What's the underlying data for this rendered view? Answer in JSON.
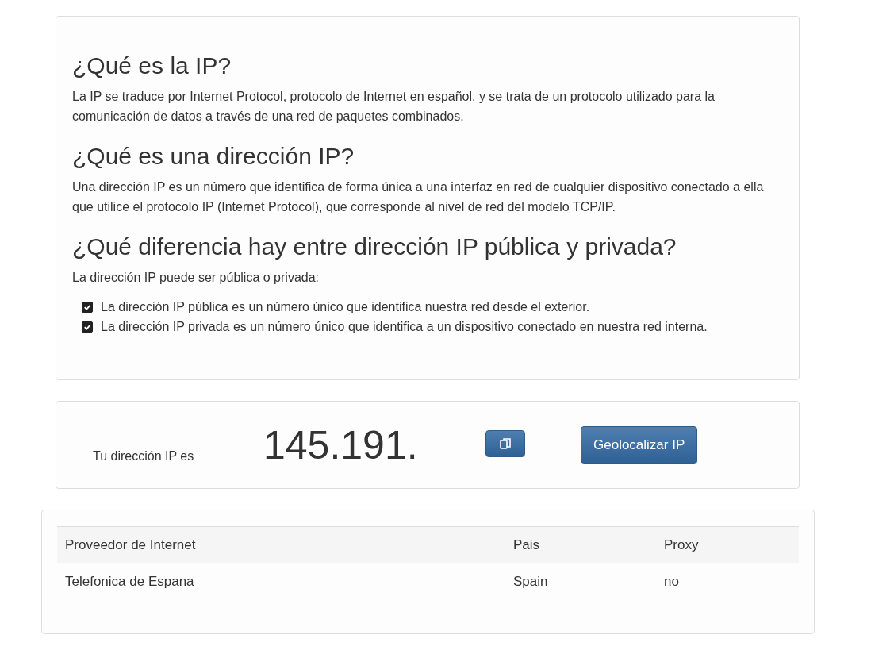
{
  "info": {
    "sections": [
      {
        "heading": "¿Qué es la IP?",
        "text": "La IP se traduce por Internet Protocol, protocolo de Internet en español, y se trata de un protocolo utilizado para la comunicación de datos a través de una red de paquetes combinados."
      },
      {
        "heading": "¿Qué es una dirección IP?",
        "text": "Una dirección IP es un número que identifica de forma única a una interfaz en red de cualquier dispositivo conectado a ella que utilice el protocolo IP (Internet Protocol), que corresponde al nivel de red del modelo TCP/IP."
      },
      {
        "heading": "¿Qué diferencia hay entre dirección IP pública y privada?",
        "text": "La dirección IP puede ser pública o privada:",
        "items": [
          {
            "text": "La dirección IP pública es un número único que identifica nuestra red desde el exterior.",
            "checked": true
          },
          {
            "text": "La dirección IP privada es un número único que identifica a un dispositivo conectado en nuestra red interna.",
            "checked": true
          }
        ]
      }
    ]
  },
  "ip_panel": {
    "label": "Tu dirección IP es",
    "ip": "145.191.",
    "button": "Geolocalizar IP"
  },
  "table": {
    "columns": [
      "Proveedor de Internet",
      "Pais",
      "Proxy"
    ],
    "rows": [
      [
        "Telefonica de Espana",
        "Spain",
        "no"
      ]
    ]
  }
}
